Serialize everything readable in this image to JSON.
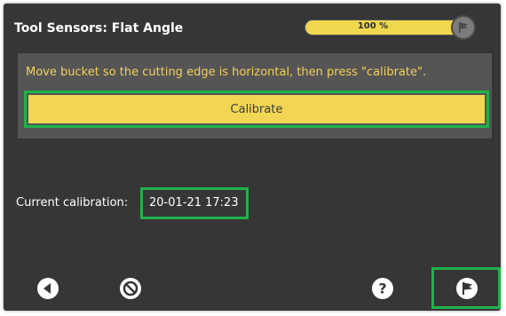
{
  "header": {
    "title": "Tool Sensors: Flat Angle",
    "progress_text": "100 %",
    "progress_value": 1.0,
    "progress_icon": "flag-icon"
  },
  "panel": {
    "instruction": "Move bucket so the cutting edge is horizontal, then press \"calibrate\".",
    "calibrate_label": "Calibrate"
  },
  "calibration": {
    "label": "Current calibration:",
    "value": "20-01-21 17:23"
  },
  "toolbar": {
    "back_icon": "back-arrow-icon",
    "cancel_icon": "cancel-icon",
    "help_icon": "help-icon",
    "finish_icon": "flag-icon"
  },
  "colors": {
    "background": "#363636",
    "panel": "#555555",
    "accent_yellow": "#f2d653",
    "highlight_green": "#1fb24a"
  }
}
